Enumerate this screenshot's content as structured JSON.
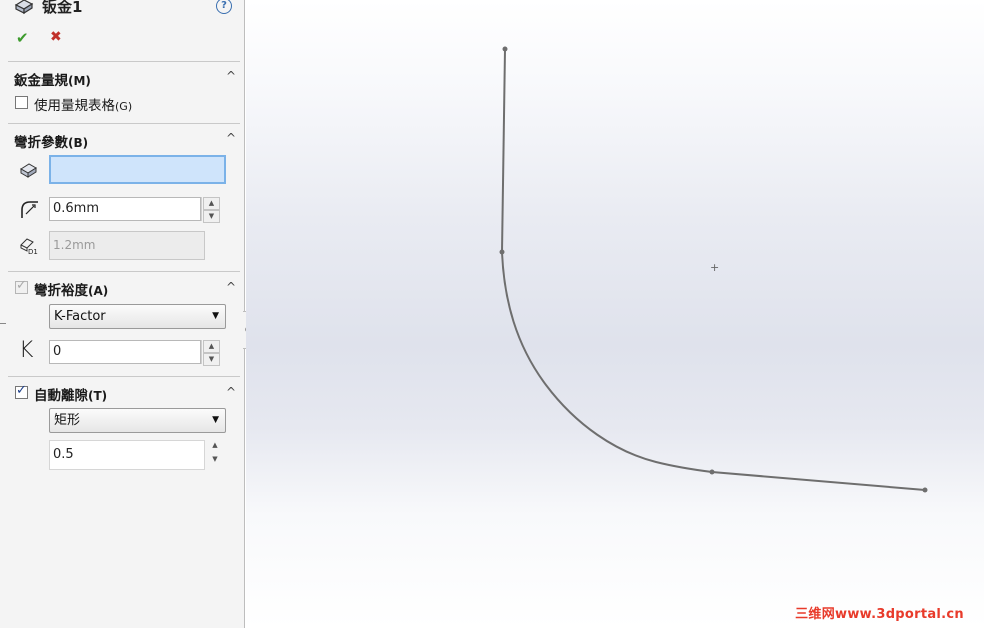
{
  "header": {
    "title": "钣金1",
    "help": "?"
  },
  "actions": {
    "ok": "✔",
    "cancel": "✖"
  },
  "gauge": {
    "title": "鈑金量規",
    "title_key": "(M)",
    "use_table_label": "使用量規表格",
    "use_table_key": "(G)",
    "use_table_checked": false
  },
  "bend_params": {
    "title": "彎折參數",
    "title_key": "(B)",
    "fixed_face_value": "",
    "radius_value": "0.6mm",
    "thickness_value": "1.2mm"
  },
  "bend_allowance": {
    "title": "彎折裕度",
    "title_key": "(A)",
    "checked": true,
    "type_value": "K-Factor",
    "k_symbol": "K",
    "k_value": "0"
  },
  "auto_relief": {
    "title": "自動離隙",
    "title_key": "(T)",
    "checked": true,
    "type_value": "矩形",
    "ratio_value": "0.5"
  },
  "viewport": {
    "origin_marker": "+"
  },
  "watermark": "三维网www.3dportal.cn"
}
